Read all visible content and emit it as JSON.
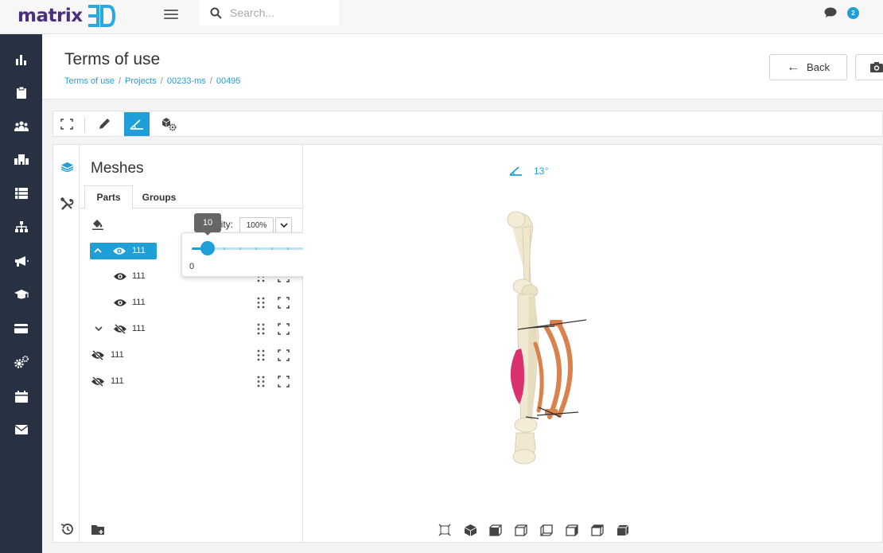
{
  "brand": {
    "name": "matrix",
    "mark": "3D",
    "color": "#4b2f7f",
    "mark_color": "#29a9e0"
  },
  "topbar": {
    "search_placeholder": "Search...",
    "notification_count": "2"
  },
  "nav": {
    "items": [
      {
        "name": "dashboard",
        "icon": "bar-chart-icon"
      },
      {
        "name": "clipboard",
        "icon": "clipboard-icon"
      },
      {
        "name": "team",
        "icon": "users-icon"
      },
      {
        "name": "organization",
        "icon": "building-icon"
      },
      {
        "name": "list",
        "icon": "list-icon"
      },
      {
        "name": "hierarchy",
        "icon": "sitemap-icon"
      },
      {
        "name": "announcements",
        "icon": "megaphone-icon"
      },
      {
        "name": "training",
        "icon": "graduation-cap-icon"
      },
      {
        "name": "billing",
        "icon": "credit-card-icon"
      },
      {
        "name": "settings",
        "icon": "gears-icon"
      },
      {
        "name": "calendar",
        "icon": "calendar-icon"
      },
      {
        "name": "messages",
        "icon": "envelope-icon"
      }
    ]
  },
  "page": {
    "title": "Terms of use",
    "breadcrumb": [
      "Terms of use",
      "Projects",
      "00233-ms",
      "00495"
    ],
    "back_label": "Back"
  },
  "meshes": {
    "title": "Meshes",
    "tabs": [
      "Parts",
      "Groups"
    ],
    "active_tab": "Parts",
    "opacity_label": "Opacity:",
    "opacity_value": "100%",
    "slider": {
      "value": 10,
      "min": "0",
      "max": "100",
      "value_label": "10"
    },
    "rows": [
      {
        "label": "111",
        "visible": true,
        "expanded": true,
        "selected": true,
        "level": 0
      },
      {
        "label": "111",
        "visible": true,
        "level": 1
      },
      {
        "label": "111",
        "visible": true,
        "level": 1
      },
      {
        "label": "111",
        "visible": false,
        "expanded": false,
        "level": 0
      },
      {
        "label": "111",
        "visible": false,
        "level": 0
      },
      {
        "label": "111",
        "visible": false,
        "level": 0
      }
    ]
  },
  "viewer": {
    "angle_value": "13",
    "angle_unit": "°"
  },
  "colors": {
    "accent": "#1e9fd8",
    "sidebar": "#273142",
    "bone": "#f0e8d0",
    "implant": "#d9824e",
    "muscle": "#d9326e"
  }
}
